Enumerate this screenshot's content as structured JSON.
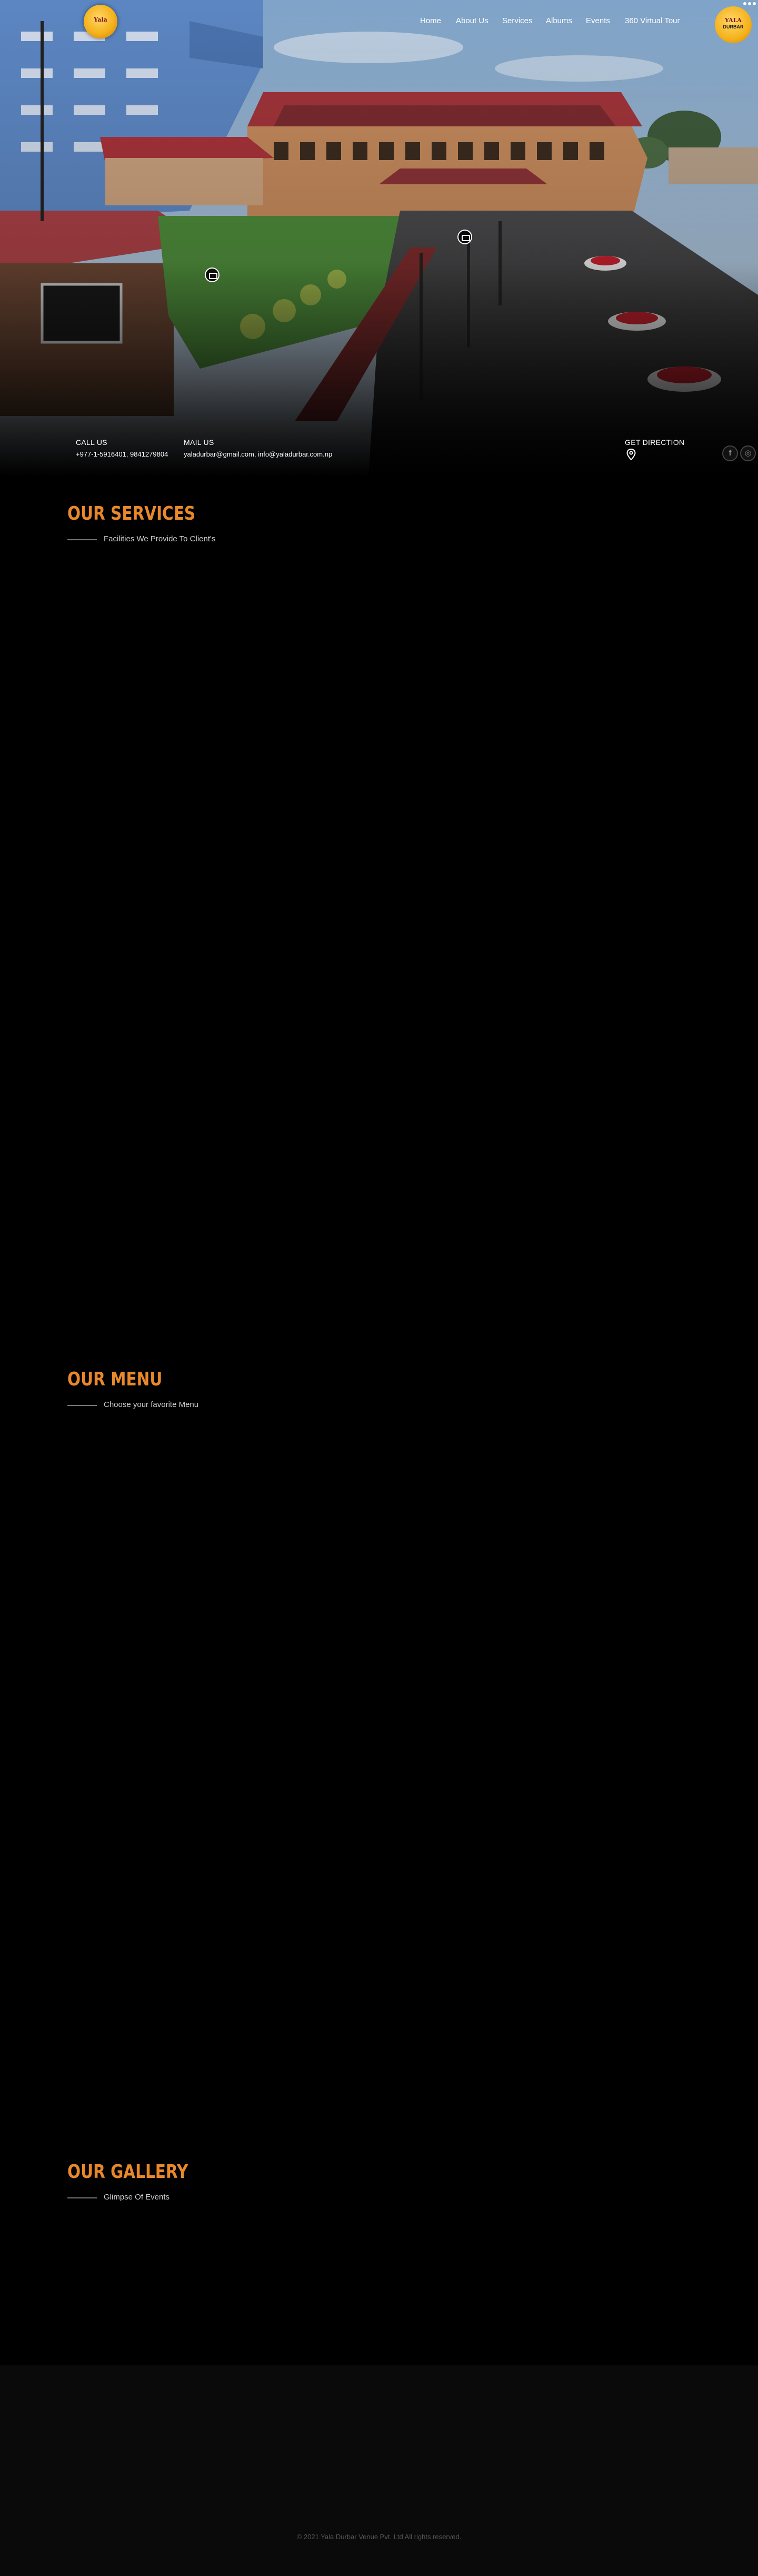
{
  "brand": {
    "logo_text": "Yala",
    "logo_right_line1": "YALA",
    "logo_right_line2": "DURBAR"
  },
  "nav": {
    "items": [
      "Home",
      "About Us",
      "Services",
      "Albums",
      "Events",
      "360 Virtual Tour"
    ]
  },
  "contact": {
    "call_label": "CALL US",
    "call_value": "+977-1-5916401, 9841279804",
    "mail_label": "MAIL US",
    "mail_value": "yaladurbar@gmail.com, info@yaladurbar.com.np",
    "direction_label": "GET DIRECTION"
  },
  "sections": {
    "services": {
      "title": "OUR SERVICES",
      "subtitle": "Facilities We Provide To Client's"
    },
    "menu": {
      "title": "OUR MENU",
      "subtitle": "Choose your favorite Menu"
    },
    "gallery": {
      "title": "OUR GALLERY",
      "subtitle": "Glimpse Of Events"
    }
  },
  "footer": {
    "copyright": "© 2021 Yala Durbar Venue Pvt. Ltd All rights reserved."
  },
  "colors": {
    "accent": "#e8882a",
    "background": "#000000",
    "footer_bg": "#0a0a0a"
  },
  "icons": {
    "direction": "map-pin-icon",
    "social_1": "facebook-icon",
    "social_2": "instagram-icon",
    "hero_markers": "photo-marker-icon"
  }
}
